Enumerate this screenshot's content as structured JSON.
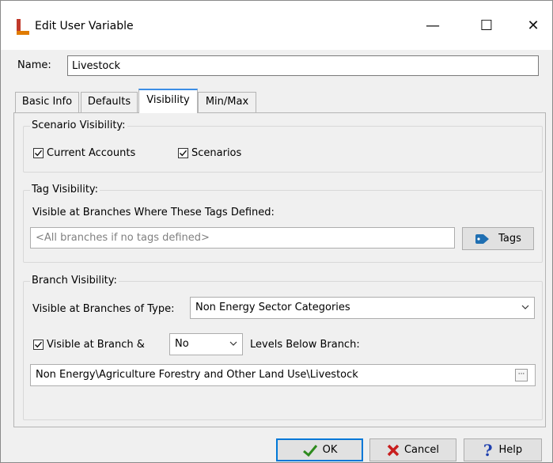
{
  "window": {
    "title": "Edit User Variable",
    "controls": {
      "minimize": "—",
      "maximize": "☐",
      "close": "✕"
    }
  },
  "name": {
    "label": "Name:",
    "value": "Livestock"
  },
  "tabs": [
    {
      "label": "Basic Info",
      "active": false
    },
    {
      "label": "Defaults",
      "active": false
    },
    {
      "label": "Visibility",
      "active": true
    },
    {
      "label": "Min/Max",
      "active": false
    }
  ],
  "scenario_visibility": {
    "title": "Scenario Visibility:",
    "current_accounts": {
      "label": "Current Accounts",
      "checked": true
    },
    "scenarios": {
      "label": "Scenarios",
      "checked": true
    }
  },
  "tag_visibility": {
    "title": "Tag Visibility:",
    "subtitle": "Visible at Branches Where These Tags Defined:",
    "placeholder": "<All branches if no tags defined>",
    "tags_button": "Tags"
  },
  "branch_visibility": {
    "title": "Branch Visibility:",
    "type_label": "Visible at Branches of Type:",
    "type_value": "Non Energy Sector Categories",
    "visible_at_branch": {
      "label": "Visible at Branch &",
      "checked": true
    },
    "levels_value": "No",
    "levels_label": "Levels Below Branch:",
    "branch_path": "Non Energy\\Agriculture Forestry and Other Land Use\\Livestock",
    "ellipsis": "···"
  },
  "buttons": {
    "ok": "OK",
    "cancel": "Cancel",
    "help": "Help"
  },
  "colors": {
    "ok_check": "#2e8b1e",
    "cancel_x": "#c81e1e",
    "help_q": "#1e3fae",
    "tag_icon": "#1f6fb2",
    "active_tab_accent": "#3c8ee6"
  }
}
